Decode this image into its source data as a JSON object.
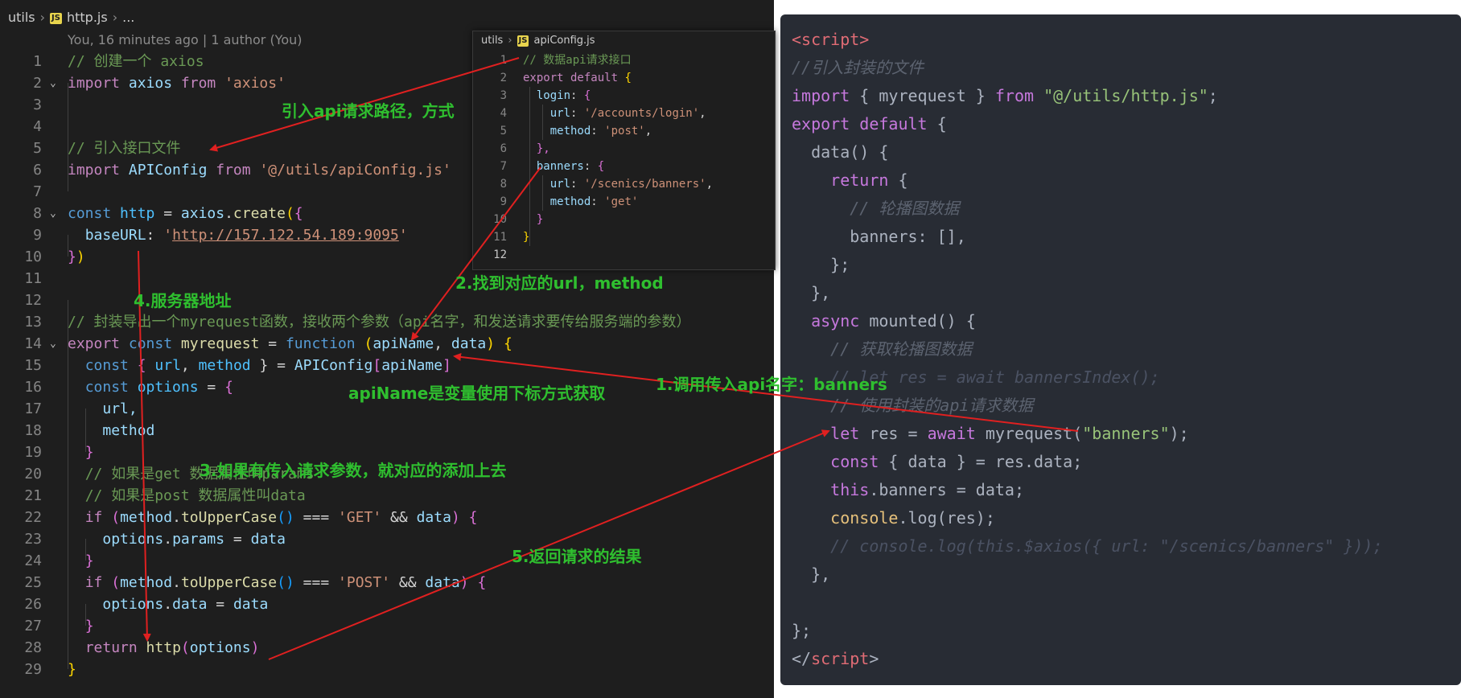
{
  "left_editor": {
    "breadcrumb": {
      "folder": "utils",
      "file_icon": "JS",
      "file": "http.js",
      "more": "..."
    },
    "blame": "You, 16 minutes ago | 1 author (You)",
    "line_numbers": [
      "1",
      "2",
      "3",
      "4",
      "5",
      "6",
      "7",
      "8",
      "9",
      "10",
      "11",
      "12",
      "13",
      "14",
      "15",
      "16",
      "17",
      "18",
      "19",
      "20",
      "21",
      "22",
      "23",
      "24",
      "25",
      "26",
      "27",
      "28",
      "29"
    ],
    "code": {
      "l1": "// 创建一个 axios",
      "l2_import": "import",
      "l2_name": " axios ",
      "l2_from": "from",
      "l2_str": " 'axios'",
      "l5": "// 引入接口文件",
      "l6_import": "import",
      "l6_name": " APIConfig ",
      "l6_from": "from",
      "l6_str": " '@/utils/apiConfig.js'",
      "l8_const": "const",
      "l8_http": " http",
      "l8_eq": " = ",
      "l8_axios": "axios",
      "l8_dot": ".",
      "l8_create": "create",
      "l8_paren": "(",
      "l8_brace": "{",
      "l9_key": "baseURL",
      "l9_colon": ": ",
      "l9_q1": "'",
      "l9_url": "http://157.122.54.189:9095",
      "l9_q2": "'",
      "l10_brace": "}",
      "l10_paren": ")",
      "l13": "// 封装导出一个myrequest函数，接收两个参数（api名字，和发送请求要传给服务端的参数）",
      "l14_export": "export",
      "l14_const": " const",
      "l14_name": " myrequest",
      "l14_eq": " = ",
      "l14_function": "function",
      "l14_open": " (",
      "l14_arg1": "apiName",
      "l14_comma": ", ",
      "l14_arg2": "data",
      "l14_close": ") ",
      "l14_brace": "{",
      "l15_const": "const",
      "l15_open": " { ",
      "l15_url": "url",
      "l15_comma": ", ",
      "l15_method": "method",
      "l15_close": " } = ",
      "l15_api": "APIConfig",
      "l15_lb": "[",
      "l15_arg": "apiName",
      "l15_rb": "]",
      "l16_const": "const",
      "l16_name": " options",
      "l16_eq": " = ",
      "l16_brace": "{",
      "l17": "url,",
      "l18": "method",
      "l19": "}",
      "l20": "// 如果是get 数据属性叫params",
      "l21": "// 如果是post 数据属性叫data",
      "l22_if": "if",
      "l22_open": " (",
      "l22_method": "method",
      "l22_dot": ".",
      "l22_fn": "toUpperCase",
      "l22_call": "()",
      "l22_eq": " === ",
      "l22_str": "'GET'",
      "l22_and": " && ",
      "l22_data": "data",
      "l22_close": ") ",
      "l22_brace": "{",
      "l23_obj": "options",
      "l23_dot": ".",
      "l23_prop": "params",
      "l23_eq": " = ",
      "l23_val": "data",
      "l24": "}",
      "l25_if": "if",
      "l25_open": " (",
      "l25_method": "method",
      "l25_dot": ".",
      "l25_fn": "toUpperCase",
      "l25_call": "()",
      "l25_eq": " === ",
      "l25_str": "'POST'",
      "l25_and": " && ",
      "l25_data": "data",
      "l25_close": ") ",
      "l25_brace": "{",
      "l26_obj": "options",
      "l26_dot": ".",
      "l26_prop": "data",
      "l26_eq": " = ",
      "l26_val": "data",
      "l27": "}",
      "l28_return": "return",
      "l28_fn": " http",
      "l28_open": "(",
      "l28_arg": "options",
      "l28_close": ")",
      "l29": "}"
    }
  },
  "inset_editor": {
    "breadcrumb": {
      "folder": "utils",
      "file_icon": "JS",
      "file": "apiConfig.js"
    },
    "line_numbers": [
      "1",
      "2",
      "3",
      "4",
      "5",
      "6",
      "7",
      "8",
      "9",
      "10",
      "11",
      "12"
    ],
    "code": {
      "l1": "// 数据api请求接口",
      "l2_export": "export",
      "l2_default": " default",
      "l2_brace": " {",
      "l3_key": "login",
      "l3_rest": ": ",
      "l3_brace": "{",
      "l4_key": "url",
      "l4_colon": ": ",
      "l4_val": "'/accounts/login'",
      "l4_comma": ",",
      "l5_key": "method",
      "l5_colon": ": ",
      "l5_val": "'post'",
      "l5_comma": ",",
      "l6": "},",
      "l7_key": "banners",
      "l7_rest": ": ",
      "l7_brace": "{",
      "l8_key": "url",
      "l8_colon": ": ",
      "l8_val": "'/scenics/banners'",
      "l8_comma": ",",
      "l9_key": "method",
      "l9_colon": ": ",
      "l9_val": "'get'",
      "l10": "}",
      "l11": "}"
    }
  },
  "right_panel": {
    "code": {
      "l1": "<script>",
      "l2": "//引入封装的文件",
      "l3_import": "import",
      "l3_mid": " { myrequest } ",
      "l3_from": "from",
      "l3_str": " \"@/utils/http.js\"",
      "l3_end": ";",
      "l4_export": "export",
      "l4_default": " default",
      "l4_brace": " {",
      "l5": "data() {",
      "l6_return": "return",
      "l6_brace": " {",
      "l7": "// 轮播图数据",
      "l8": "banners: [],",
      "l9": "};",
      "l10": "},",
      "l11_async": "async",
      "l11_rest": " mounted() {",
      "l12": "// 获取轮播图数据",
      "l13": "// let res = await bannersIndex();",
      "l14": "// 使用封装的api请求数据",
      "l15_let": "let",
      "l15_res": " res = ",
      "l15_await": "await",
      "l15_call": " myrequest(",
      "l15_str": "\"banners\"",
      "l15_end": ");",
      "l16_const": "const",
      "l16_rest": " { data } = res.data;",
      "l17_this": "this",
      "l17_rest": ".banners = data;",
      "l18_console": "console",
      "l18_rest": ".log(res);",
      "l19": "// console.log(this.$axios({ url: \"/scenics/banners\" }));",
      "l20": "},",
      "l22": "};",
      "l23_open": "</",
      "l23_tag": "script",
      "l23_close": ">"
    }
  },
  "annotations": {
    "a1": "引入api请求路径，方式",
    "a2": "2.找到对应的url，method",
    "a3": "4.服务器地址",
    "a4": "1.调用传入api名字：banners",
    "a5": "apiName是变量使用下标方式获取",
    "a6": "3.如果有传入请求参数，就对应的添加上去",
    "a7": "5.返回请求的结果"
  },
  "colors": {
    "editor_bg": "#1e1e1e",
    "panel_bg": "#282c34",
    "annotation_green": "#2fbf2f",
    "arrow_red": "#e02020"
  }
}
